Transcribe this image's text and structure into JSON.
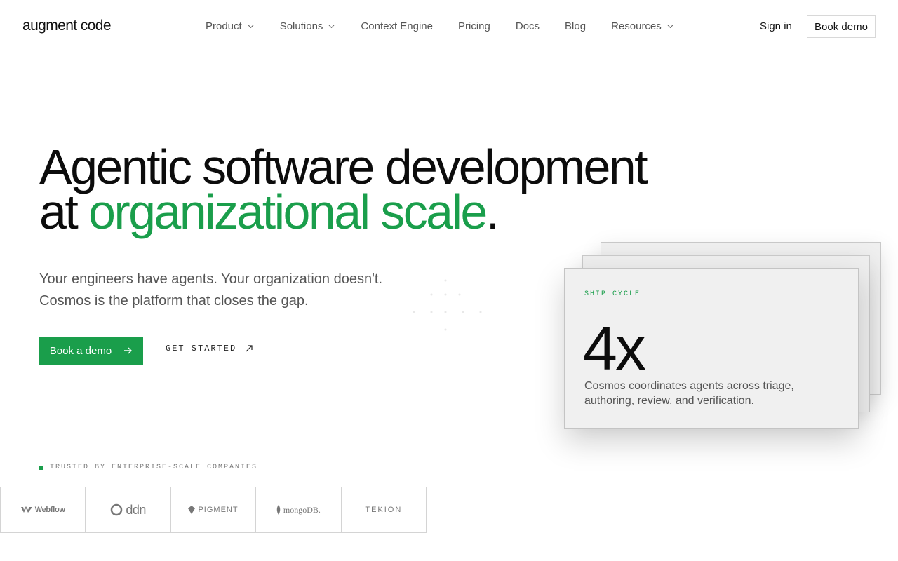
{
  "header": {
    "logo": "augment code",
    "nav": [
      {
        "label": "Product",
        "dropdown": true
      },
      {
        "label": "Solutions",
        "dropdown": true
      },
      {
        "label": "Context Engine",
        "dropdown": false
      },
      {
        "label": "Pricing",
        "dropdown": false
      },
      {
        "label": "Docs",
        "dropdown": false
      },
      {
        "label": "Blog",
        "dropdown": false
      },
      {
        "label": "Resources",
        "dropdown": true
      }
    ],
    "sign_in": "Sign in",
    "book_demo": "Book demo"
  },
  "hero": {
    "title_line1": "Agentic software development",
    "title_line2_prefix": "at ",
    "title_line2_accent": "organizational scale",
    "title_line2_suffix": ".",
    "subtitle_line1": "Your engineers have agents. Your organization doesn't.",
    "subtitle_line2": "Cosmos is the platform that closes the gap.",
    "cta_primary": "Book a demo",
    "cta_secondary": "GET STARTED"
  },
  "trusted": {
    "label": "TRUSTED BY ENTERPRISE-SCALE COMPANIES",
    "logos": [
      "Webflow",
      "ddn",
      "PIGMENT",
      "mongoDB.",
      "TEKION"
    ]
  },
  "card": {
    "label": "SHIP CYCLE",
    "stat": "4x",
    "description": "Cosmos coordinates agents across triage, authoring, review, and verification."
  },
  "colors": {
    "accent": "#1a9e4b",
    "text": "#0c0c0c",
    "muted": "#555555"
  }
}
